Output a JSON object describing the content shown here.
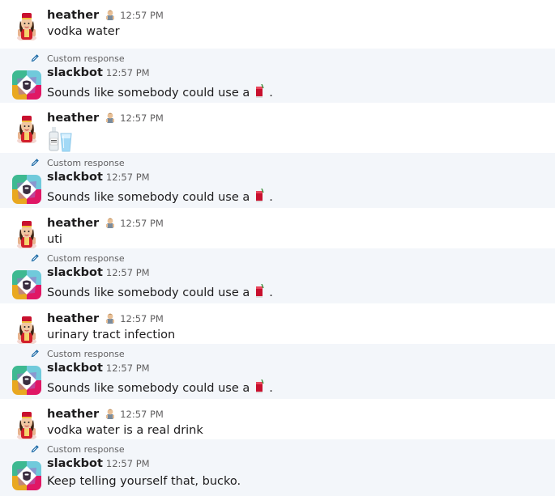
{
  "labels": {
    "custom_response": "Custom response"
  },
  "icons": {
    "avatar_heather": "woman-with-red-fez-avatar",
    "avatar_slackbot": "slackbot-avatar",
    "badge": "person-emoji-badge",
    "pencil": "pencil-icon",
    "drink": "cocktail-emoji",
    "vodka_water": "vodka-bottle-and-water-glass-emoji"
  },
  "colors": {
    "bot_bg": "#f3f6fa",
    "secondary_text": "#616061",
    "drink": "#c8102e"
  },
  "messages": [
    {
      "author": "heather",
      "time": "12:57 PM",
      "text": "vodka water"
    },
    {
      "author": "slackbot",
      "time": "12:57 PM",
      "custom": "Custom response",
      "text": "Sounds like somebody could use a",
      "suffix": "."
    },
    {
      "author": "heather",
      "time": "12:57 PM",
      "text": ""
    },
    {
      "author": "slackbot",
      "time": "12:57 PM",
      "custom": "Custom response",
      "text": "Sounds like somebody could use a",
      "suffix": "."
    },
    {
      "author": "heather",
      "time": "12:57 PM",
      "text": "uti"
    },
    {
      "author": "slackbot",
      "time": "12:57 PM",
      "custom": "Custom response",
      "text": "Sounds like somebody could use a",
      "suffix": "."
    },
    {
      "author": "heather",
      "time": "12:57 PM",
      "text": "urinary tract infection"
    },
    {
      "author": "slackbot",
      "time": "12:57 PM",
      "custom": "Custom response",
      "text": "Sounds like somebody could use a",
      "suffix": "."
    },
    {
      "author": "heather",
      "time": "12:57 PM",
      "text": "vodka water is a real drink"
    },
    {
      "author": "slackbot",
      "time": "12:57 PM",
      "custom": "Custom response",
      "text": "Keep telling yourself that, bucko.",
      "suffix": ""
    }
  ]
}
